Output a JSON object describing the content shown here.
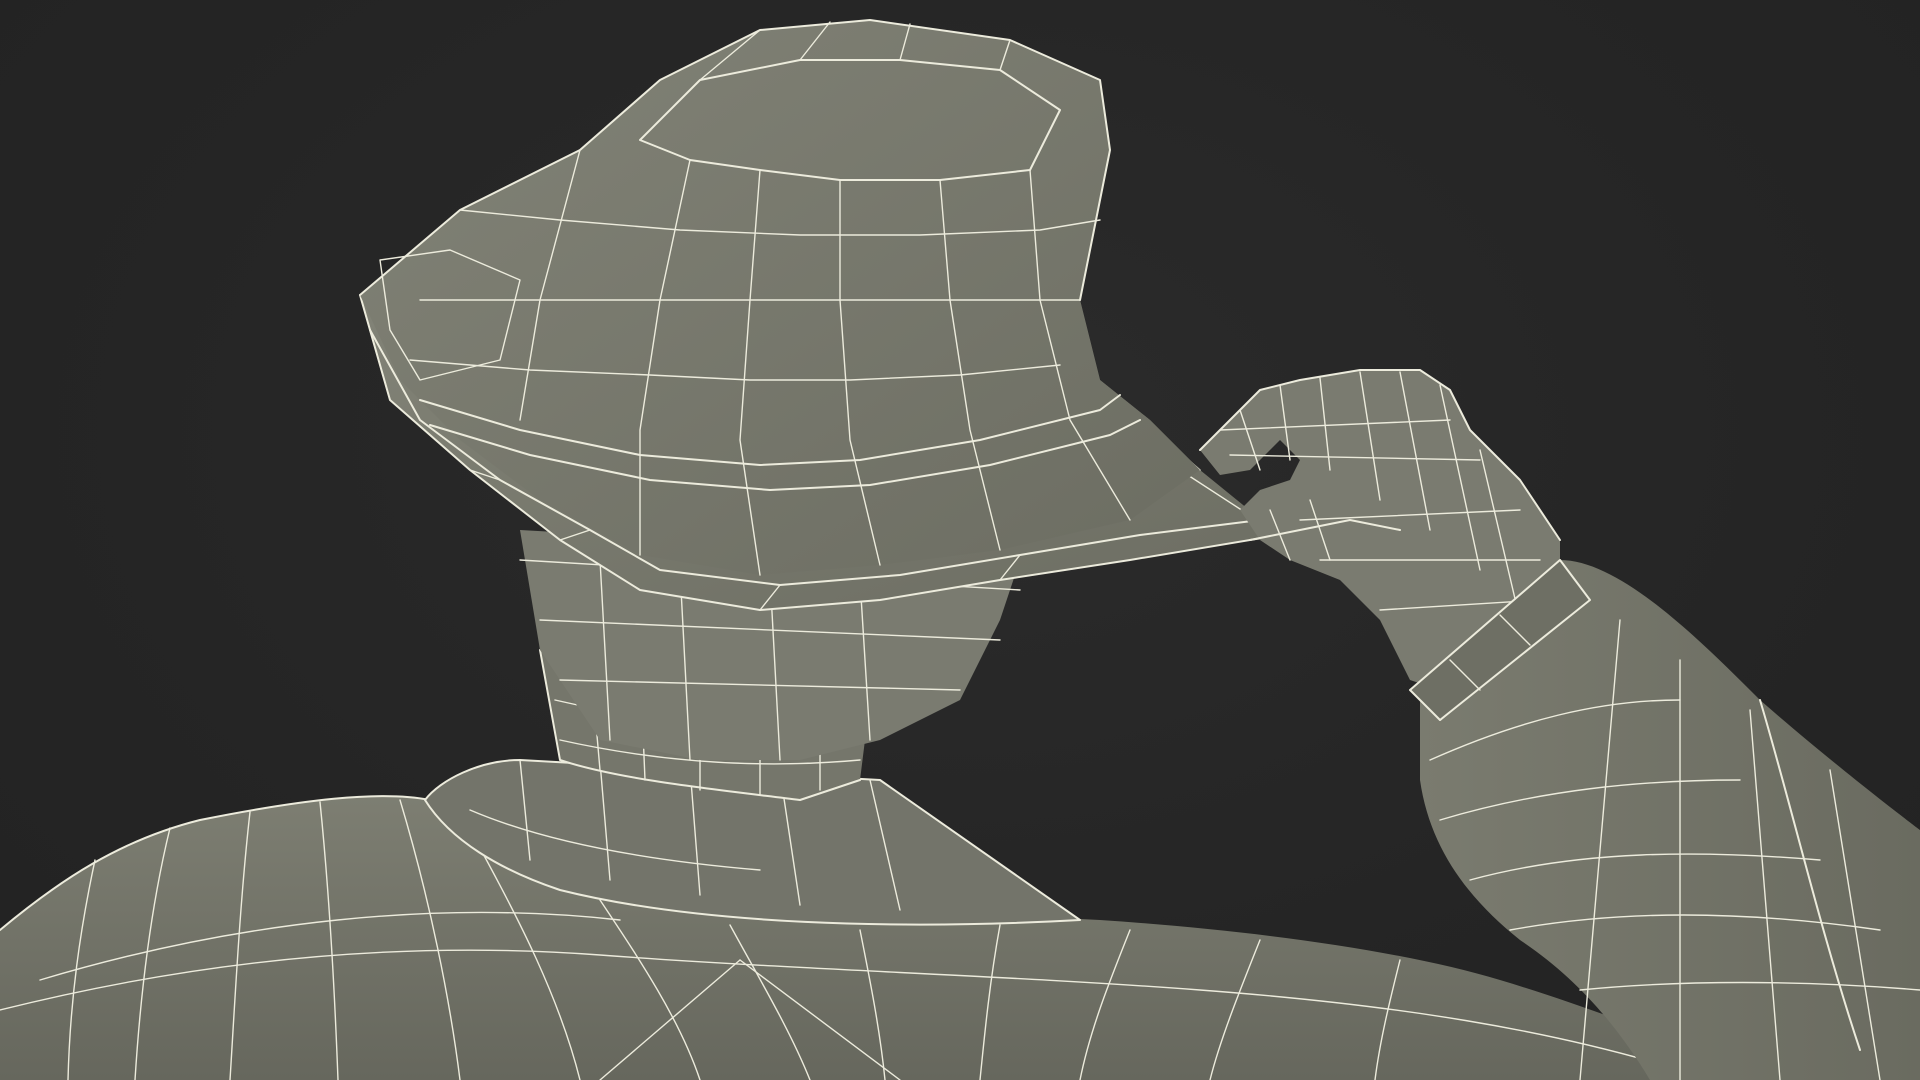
{
  "scene": {
    "subject": "figure",
    "background_color": "#262626",
    "surface_color": "#7b7c70",
    "surface_shadow_color": "#5e5f55",
    "surface_light_color": "#8a8b7f",
    "wireframe_color": "#ecebdc"
  }
}
